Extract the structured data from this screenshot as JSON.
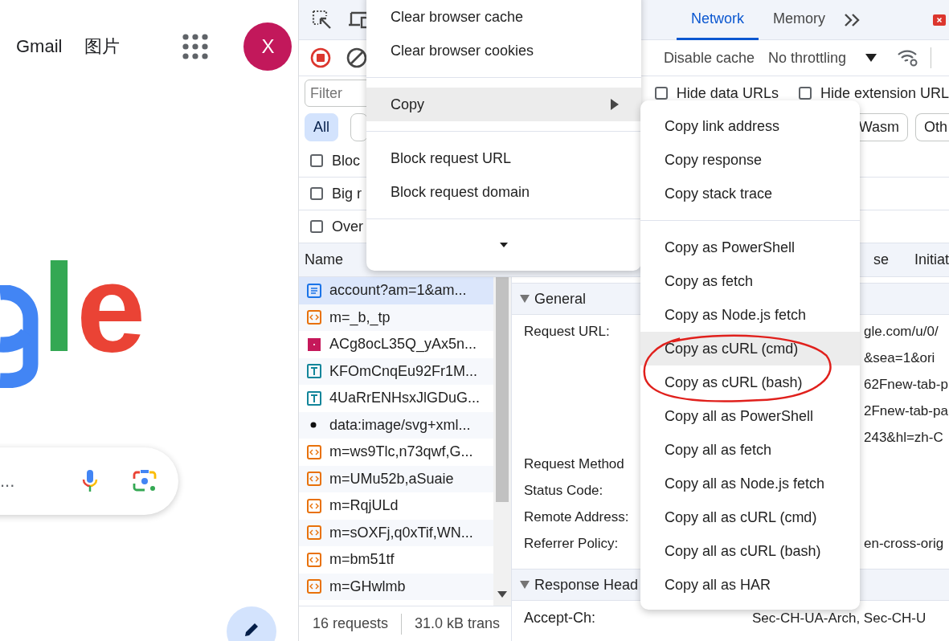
{
  "google_page": {
    "links": [
      "Gmail",
      "图片"
    ],
    "avatar": "X",
    "logo_letters": [
      {
        "text": "l",
        "color": "#34a853"
      },
      {
        "text": "e",
        "color": "#ea4335"
      }
    ],
    "search_placeholder": "..."
  },
  "devtools": {
    "tabs": [
      {
        "label": "Network",
        "selected": true
      },
      {
        "label": "Memory",
        "selected": false
      }
    ],
    "disable_cache": "Disable cache",
    "throttling": "No throttling",
    "filter": {
      "placeholder": "Filter"
    },
    "hide_options": [
      {
        "label": "Hide data URLs",
        "checked": false
      },
      {
        "label": "Hide extension URL",
        "checked": false
      }
    ],
    "type_filters_left": [
      {
        "label": "All",
        "selected": true
      },
      {
        "selected": false
      }
    ],
    "type_filters_right": [
      {
        "label": "Wasm",
        "selected": false
      },
      {
        "label": "Oth",
        "selected": false
      }
    ],
    "options": [
      {
        "label": "Bloc",
        "checked": false
      },
      {
        "label": "Big r",
        "checked": false
      },
      {
        "label": "Over",
        "checked": false
      }
    ],
    "name_column": "Name",
    "detail_tabs": [
      "se",
      "Initiat"
    ],
    "requests": [
      {
        "name": "account?am=1&am...",
        "kind": "document",
        "selected": true
      },
      {
        "name": "m=_b,_tp",
        "kind": "script",
        "selected": false
      },
      {
        "name": "ACg8ocL35Q_yAx5n...",
        "kind": "image",
        "selected": false
      },
      {
        "name": "KFOmCnqEu92Fr1M...",
        "kind": "font",
        "selected": false
      },
      {
        "name": "4UaRrENHsxJlGDuG...",
        "kind": "font",
        "selected": false
      },
      {
        "name": "data:image/svg+xml...",
        "kind": "data",
        "selected": false
      },
      {
        "name": "m=ws9Tlc,n73qwf,G...",
        "kind": "script",
        "selected": false
      },
      {
        "name": "m=UMu52b,aSuaie",
        "kind": "script",
        "selected": false
      },
      {
        "name": "m=RqjULd",
        "kind": "script",
        "selected": false
      },
      {
        "name": "m=sOXFj,q0xTif,WN...",
        "kind": "script",
        "selected": false
      },
      {
        "name": "m=bm51tf",
        "kind": "script",
        "selected": false
      },
      {
        "name": "m=GHwlmb",
        "kind": "script",
        "selected": false
      }
    ],
    "status": {
      "requests": "16 requests",
      "transferred": "31.0 kB trans"
    },
    "general": {
      "title": "General",
      "expanded": true,
      "url": {
        "label": "Request URL:",
        "value_lines": [
          "gle.com/u/0/",
          "&sea=1&ori",
          "62Fnew-tab-p",
          "2Fnew-tab-pa",
          "243&hl=zh-C"
        ]
      },
      "fields": [
        {
          "label": "Request Method"
        },
        {
          "label": "Status Code:"
        },
        {
          "label": "Remote Address:"
        },
        {
          "label": "Referrer Policy:",
          "value": "en-cross-orig"
        }
      ]
    },
    "response_headers": {
      "title": "Response Head",
      "expanded": true,
      "fields": [
        {
          "label": "Accept-Ch:",
          "value": "Sec-CH-UA-Arch, Sec-CH-U"
        }
      ]
    }
  },
  "context_menu": {
    "groups": [
      {
        "items": [
          {
            "label": "Clear browser cache",
            "highlighted": false,
            "has_submenu": false
          },
          {
            "label": "Clear browser cookies",
            "highlighted": false,
            "has_submenu": false
          }
        ]
      },
      {
        "items": [
          {
            "label": "Copy",
            "highlighted": true,
            "has_submenu": true
          }
        ]
      },
      {
        "items": [
          {
            "label": "Block request URL",
            "highlighted": false,
            "has_submenu": false
          },
          {
            "label": "Block request domain",
            "highlighted": false,
            "has_submenu": false
          }
        ]
      }
    ],
    "more_indicator": true
  },
  "copy_submenu": {
    "groups": [
      {
        "items": [
          {
            "label": "Copy link address",
            "highlighted": false,
            "has_submenu": false
          },
          {
            "label": "Copy response",
            "highlighted": false,
            "has_submenu": false
          },
          {
            "label": "Copy stack trace",
            "highlighted": false,
            "has_submenu": false
          }
        ]
      },
      {
        "items": [
          {
            "label": "Copy as PowerShell",
            "highlighted": false,
            "has_submenu": false
          },
          {
            "label": "Copy as fetch",
            "highlighted": false,
            "has_submenu": false
          },
          {
            "label": "Copy as Node.js fetch",
            "highlighted": false,
            "has_submenu": false
          },
          {
            "label": "Copy as cURL (cmd)",
            "highlighted": true,
            "has_submenu": false
          },
          {
            "label": "Copy as cURL (bash)",
            "highlighted": false,
            "has_submenu": false
          },
          {
            "label": "Copy all as PowerShell",
            "highlighted": false,
            "has_submenu": false
          },
          {
            "label": "Copy all as fetch",
            "highlighted": false,
            "has_submenu": false
          },
          {
            "label": "Copy all as Node.js fetch",
            "highlighted": false,
            "has_submenu": false
          },
          {
            "label": "Copy all as cURL (cmd)",
            "highlighted": false,
            "has_submenu": false
          },
          {
            "label": "Copy all as cURL (bash)",
            "highlighted": false,
            "has_submenu": false
          },
          {
            "label": "Copy all as HAR",
            "highlighted": false,
            "has_submenu": false
          }
        ]
      }
    ]
  },
  "annotation": {
    "kind": "hand-drawn-ellipse"
  }
}
